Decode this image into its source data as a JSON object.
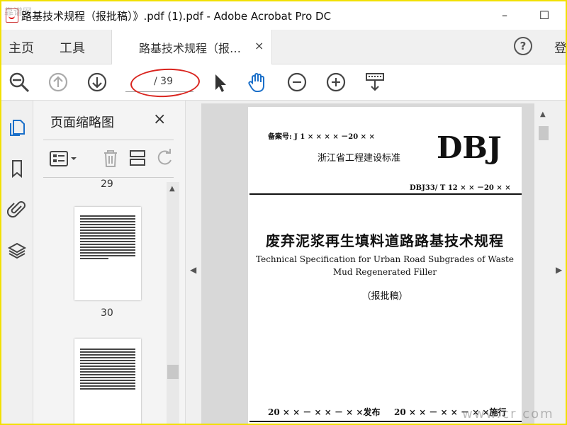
{
  "window": {
    "title": "路基技术规程（报批稿）》.pdf (1).pdf - Adobe Acrobat Pro DC",
    "watermark": "靠谱网"
  },
  "menu": {
    "home": "主页",
    "tools": "工具",
    "tab_label": "路基技术规程（报…",
    "tab_close": "×",
    "help": "?",
    "signin": "登"
  },
  "toolbar": {
    "page_current": "",
    "page_total": "/ 39"
  },
  "thumbnails": {
    "title": "页面缩略图",
    "close": "×",
    "pages": [
      {
        "label": "29"
      },
      {
        "label": "30"
      },
      {
        "label": ""
      }
    ]
  },
  "document": {
    "record_no": "备案号: J 1 × × × × －20 × ×",
    "standard": "浙江省工程建设标准",
    "logo": "DBJ",
    "code": "DBJ33/ T 12 × × －20 × ×",
    "title_cn": "废弃泥浆再生填料道路路基技术规程",
    "title_en_1": "Technical Specification for Urban Road Subgrades of Waste",
    "title_en_2": "Mud Regenerated Filler",
    "draft": "（报批稿）",
    "issue_date": "20 × × －  × × － × ×发布",
    "impl_date": "20 × × － × × － × ×施行"
  },
  "watermark_bottom": "www.cr    com",
  "colors": {
    "frame": "#f2e000",
    "annotation": "#d9241e",
    "accent": "#1a6fc9"
  }
}
